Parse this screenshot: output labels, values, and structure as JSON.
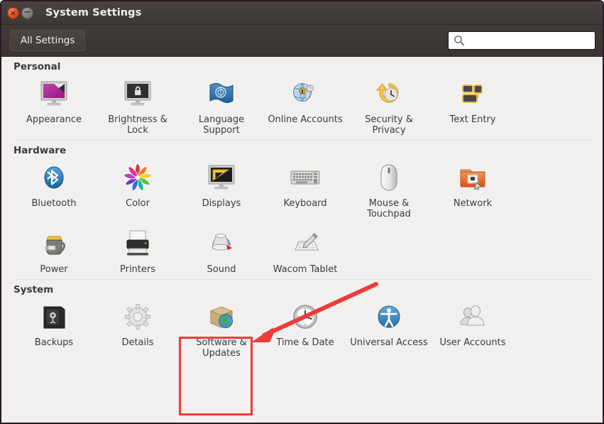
{
  "window": {
    "title": "System Settings",
    "close_label": "×",
    "minimize_label": "−"
  },
  "toolbar": {
    "all_settings_label": "All Settings",
    "search_value": "",
    "search_placeholder": "",
    "search_icon": "search-icon"
  },
  "annotation": {
    "highlight_color": "#ef3b39",
    "arrow_color": "#ef3b39",
    "highlighted_item": "Software & Updates"
  },
  "sections": [
    {
      "id": "personal",
      "title": "Personal",
      "items": [
        {
          "label": "Appearance",
          "icon": "appearance-icon"
        },
        {
          "label": "Brightness & Lock",
          "icon": "brightness-lock-icon"
        },
        {
          "label": "Language Support",
          "icon": "language-support-icon"
        },
        {
          "label": "Online Accounts",
          "icon": "online-accounts-icon"
        },
        {
          "label": "Security & Privacy",
          "icon": "security-privacy-icon"
        },
        {
          "label": "Text Entry",
          "icon": "text-entry-icon"
        }
      ]
    },
    {
      "id": "hardware",
      "title": "Hardware",
      "items": [
        {
          "label": "Bluetooth",
          "icon": "bluetooth-icon"
        },
        {
          "label": "Color",
          "icon": "color-icon"
        },
        {
          "label": "Displays",
          "icon": "displays-icon"
        },
        {
          "label": "Keyboard",
          "icon": "keyboard-icon"
        },
        {
          "label": "Mouse & Touchpad",
          "icon": "mouse-touchpad-icon"
        },
        {
          "label": "Network",
          "icon": "network-icon"
        },
        {
          "label": "Power",
          "icon": "power-icon"
        },
        {
          "label": "Printers",
          "icon": "printers-icon"
        },
        {
          "label": "Sound",
          "icon": "sound-icon"
        },
        {
          "label": "Wacom Tablet",
          "icon": "wacom-tablet-icon"
        }
      ]
    },
    {
      "id": "system",
      "title": "System",
      "items": [
        {
          "label": "Backups",
          "icon": "backups-icon"
        },
        {
          "label": "Details",
          "icon": "details-icon"
        },
        {
          "label": "Software & Updates",
          "icon": "software-updates-icon"
        },
        {
          "label": "Time & Date",
          "icon": "time-date-icon"
        },
        {
          "label": "Universal Access",
          "icon": "universal-access-icon"
        },
        {
          "label": "User Accounts",
          "icon": "user-accounts-icon"
        }
      ]
    }
  ]
}
